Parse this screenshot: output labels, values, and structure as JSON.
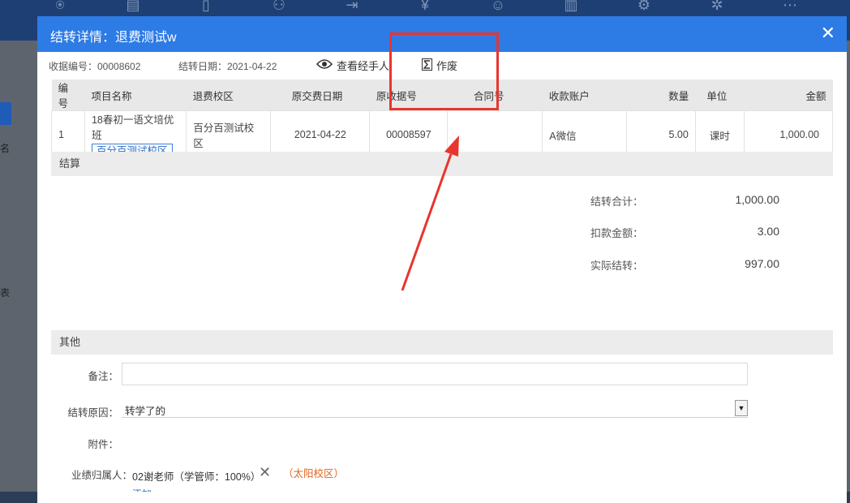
{
  "dialog": {
    "title": "结转详情：退费测试w",
    "receipt_no": "收据编号：00008602",
    "transfer_date": "结转日期：2021-04-22",
    "view_handler_label": "查看经手人",
    "void_label": "作废"
  },
  "table": {
    "headers": [
      "编号",
      "项目名称",
      "退费校区",
      "原交费日期",
      "原收据号",
      "合同号",
      "收款账户",
      "数量",
      "单位",
      "金额"
    ],
    "row": {
      "no": "1",
      "item_name": "18春初一语文培优班",
      "item_campus": "百分百测试校区",
      "refund_campus": "百分百测试校区",
      "orig_date": "2021-04-22",
      "orig_receipt": "00008597",
      "contract_no": "",
      "account": "A微信",
      "qty": "5.00",
      "unit": "课时",
      "amount": "1,000.00"
    }
  },
  "settlement": {
    "section_title": "结算",
    "total_label": "结转合计：",
    "total_value": "1,000.00",
    "deduct_label": "扣款金额：",
    "deduct_value": "3.00",
    "actual_label": "实际结转：",
    "actual_value": "997.00"
  },
  "other": {
    "section_title": "其他",
    "remark_label": "备注：",
    "reason_label": "结转原因：",
    "reason_value": "转学了的",
    "attachment_label": "附件：",
    "owner_label": "业绩归属人：",
    "owner_value": "02谢老师（学管师：100%）",
    "owner_campus": "（太阳校区）",
    "add_link": "添加"
  },
  "side_texts": [
    "名",
    "表"
  ],
  "colors": {
    "header_blue": "#2d7be5",
    "annotation_red": "#e8352e",
    "campus_orange": "#e0671d"
  }
}
